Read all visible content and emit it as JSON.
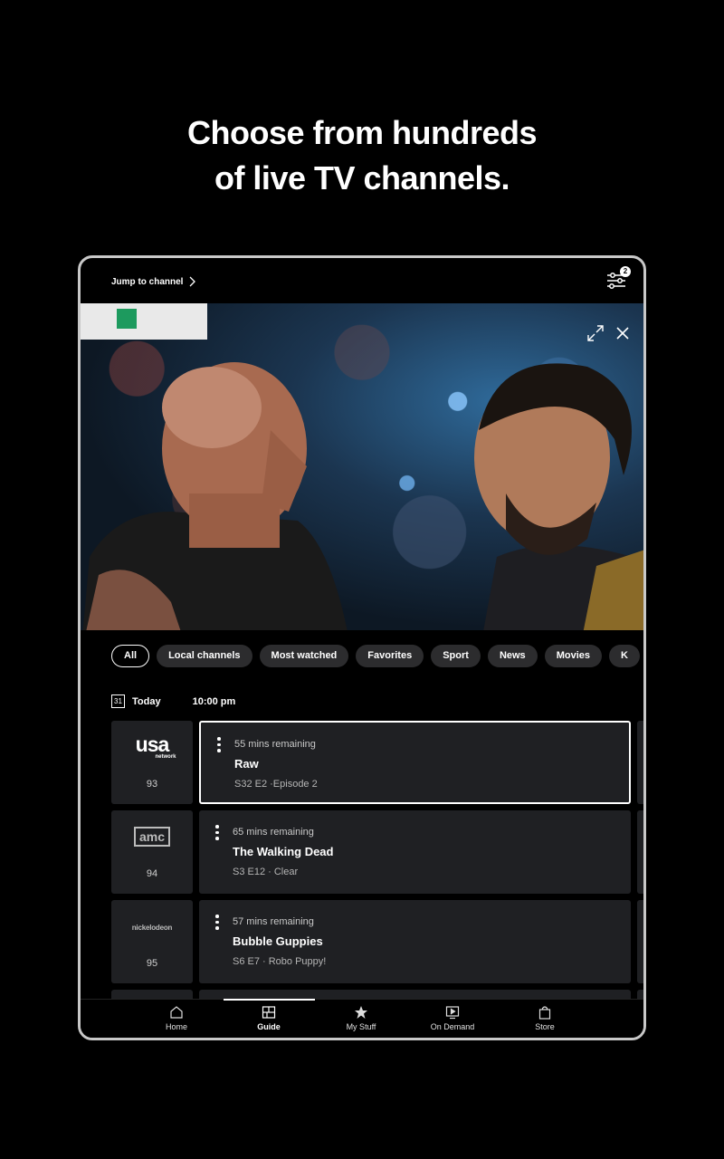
{
  "headline": {
    "line1": "Choose from hundreds",
    "line2": "of live TV channels."
  },
  "topbar": {
    "jump_label": "Jump to channel",
    "filter_count": "2"
  },
  "chips": [
    "All",
    "Local channels",
    "Most watched",
    "Favorites",
    "Sport",
    "News",
    "Movies",
    "K"
  ],
  "date": {
    "day": "Today",
    "calendar_num": "31",
    "time": "10:00 pm"
  },
  "channels": [
    {
      "logo": "usa",
      "logo_sub": "network",
      "number": "93",
      "remaining": "55 mins remaining",
      "title": "Raw",
      "desc": "S32 E2 ·Episode 2",
      "selected": true
    },
    {
      "logo": "amc",
      "number": "94",
      "remaining": "65 mins remaining",
      "title": "The Walking Dead",
      "desc": "S3 E12 · Clear",
      "selected": false
    },
    {
      "logo": "nickelodeon",
      "number": "95",
      "remaining": "57 mins remaining",
      "title": "Bubble Guppies",
      "desc": "S6 E7 · Robo Puppy!",
      "selected": false
    }
  ],
  "nav": {
    "home": "Home",
    "guide": "Guide",
    "mystuff": "My Stuff",
    "ondemand": "On Demand",
    "store": "Store"
  },
  "icons": [
    "chevron-right-icon",
    "filter-sliders-icon",
    "expand-icon",
    "close-icon",
    "calendar-icon",
    "home-icon",
    "guide-icon",
    "star-icon",
    "on-demand-icon",
    "store-bag-icon"
  ]
}
